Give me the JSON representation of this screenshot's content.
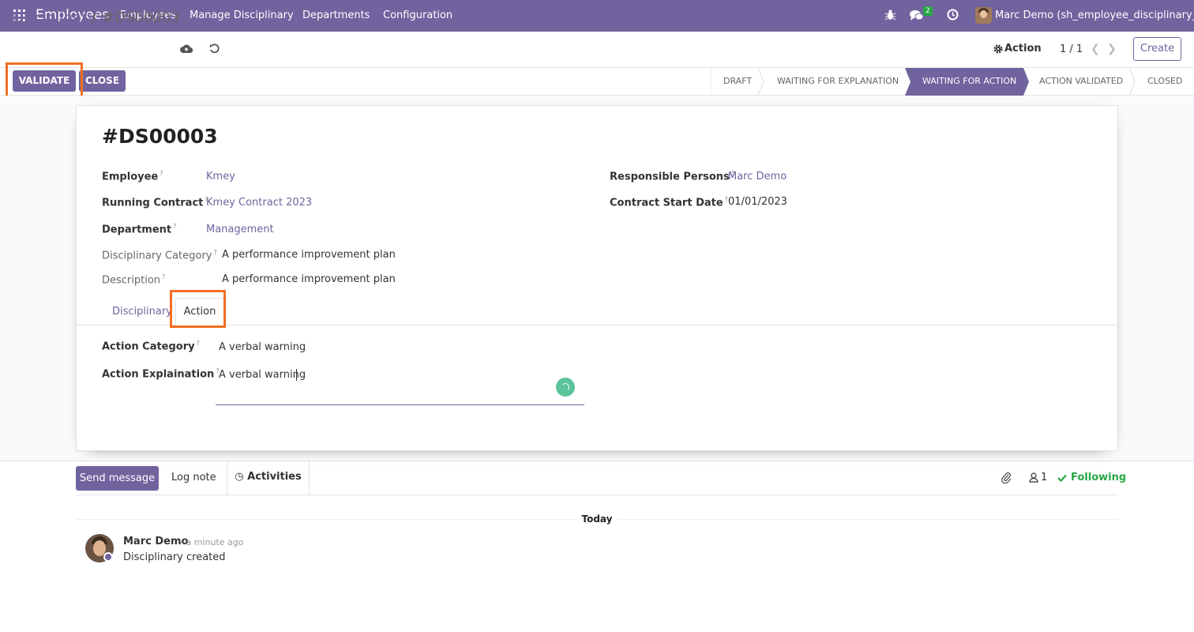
{
  "app": {
    "brand": "Employees",
    "menu": [
      "Employees",
      "Manage Disciplinary",
      "Departments",
      "Configuration"
    ],
    "chat_count": "2",
    "user": "Marc Demo (sh_employee_disciplinary__)"
  },
  "control": {
    "breadcrumb_parent": "Disciplinary",
    "breadcrumb_sep": "/",
    "breadcrumb_current": "#DS00003",
    "action_label": "Action",
    "pager": "1 / 1",
    "create_label": "Create"
  },
  "statusbar": {
    "validate_label": "VALIDATE",
    "close_label": "CLOSE",
    "stages": [
      "DRAFT",
      "WAITING FOR EXPLANATION",
      "WAITING FOR ACTION",
      "ACTION VALIDATED",
      "CLOSED"
    ],
    "active_stage": "WAITING FOR ACTION"
  },
  "record": {
    "title": "#DS00003",
    "fields": {
      "employee_label": "Employee",
      "employee_value": "Kmey",
      "contract_label": "Running Contract",
      "contract_value": "Kmey Contract 2023",
      "department_label": "Department",
      "department_value": "Management",
      "category_label": "Disciplinary Category",
      "category_value": "A performance improvement plan",
      "description_label": "Description",
      "description_value": "A performance improvement plan",
      "responsible_label": "Responsible Persons",
      "responsible_value": "Marc Demo",
      "start_date_label": "Contract Start Date",
      "start_date_value": "01/01/2023"
    },
    "tabs": [
      "Disciplinary",
      "Action"
    ],
    "active_tab": "Action",
    "action": {
      "category_label": "Action Category",
      "category_value": "A verbal warning",
      "explanation_label": "Action Explaination",
      "explanation_value": "A verbal warning"
    }
  },
  "chatter": {
    "send_label": "Send message",
    "log_label": "Log note",
    "activities_label": "Activities",
    "followers_count": "1",
    "following_label": "Following",
    "today_label": "Today",
    "messages": [
      {
        "author": "Marc Demo",
        "date": "- a minute ago",
        "body": "Disciplinary created"
      }
    ]
  },
  "colors": {
    "brand": "#71639e",
    "highlight": "#f26f21",
    "success": "#28a745"
  }
}
